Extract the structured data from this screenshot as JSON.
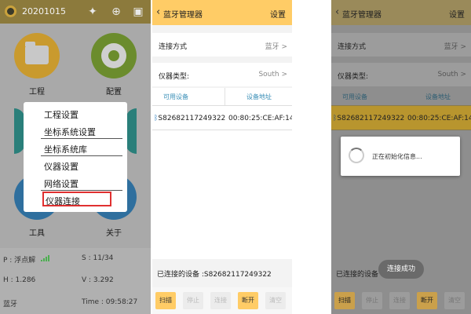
{
  "panel1": {
    "date": "20201015",
    "tiles": [
      {
        "label": "工程"
      },
      {
        "label": "配置"
      },
      {
        "label": "工具"
      },
      {
        "label": "关于"
      }
    ],
    "menu": [
      "工程设置",
      "坐标系统设置",
      "坐标系统库",
      "仪器设置",
      "网络设置",
      "仪器连接"
    ],
    "status": {
      "p": "P : 浮点解",
      "s": "S : 11/34",
      "h": "H : 1.286",
      "v": "V : 3.292",
      "conn": "蓝牙",
      "time": "Time :  09:58:27"
    }
  },
  "panel2": {
    "title": "蓝牙管理器",
    "settings": "设置",
    "conn_method_label": "连接方式",
    "conn_method_value": "蓝牙 >",
    "instr_type_label": "仪器类型:",
    "instr_type_value": "South >",
    "col_device": "可用设备",
    "col_address": "设备地址",
    "device_name": "S82682117249322",
    "device_addr": "00:80:25:CE:AF:14",
    "connected": "已连接的设备 :S82682117249322",
    "buttons": [
      "扫描",
      "停止",
      "连接",
      "断开",
      "清空"
    ]
  },
  "panel3": {
    "title": "蓝牙管理器",
    "settings": "设置",
    "conn_method_label": "连接方式",
    "conn_method_value": "蓝牙 >",
    "instr_type_label": "仪器类型:",
    "instr_type_value": "South >",
    "col_device": "可用设备",
    "col_address": "设备地址",
    "device_name": "S82682117249322",
    "device_addr": "00:80:25:CE:AF:14",
    "dialog_text": "正在初始化信息...",
    "connected": "已连接的设备 :",
    "toast": "连接成功",
    "buttons": [
      "扫描",
      "停止",
      "连接",
      "断开",
      "清空"
    ]
  },
  "colors": {
    "header_yellow": "#ffcc66",
    "list_header_blue": "#3a8fb7",
    "highlight_red": "#e03030",
    "tile_folder": "#c99a2e",
    "tile_gear": "#6b8c2d",
    "tile_teal": "#2a7f7a",
    "tile_blue": "#2f6f9e"
  }
}
